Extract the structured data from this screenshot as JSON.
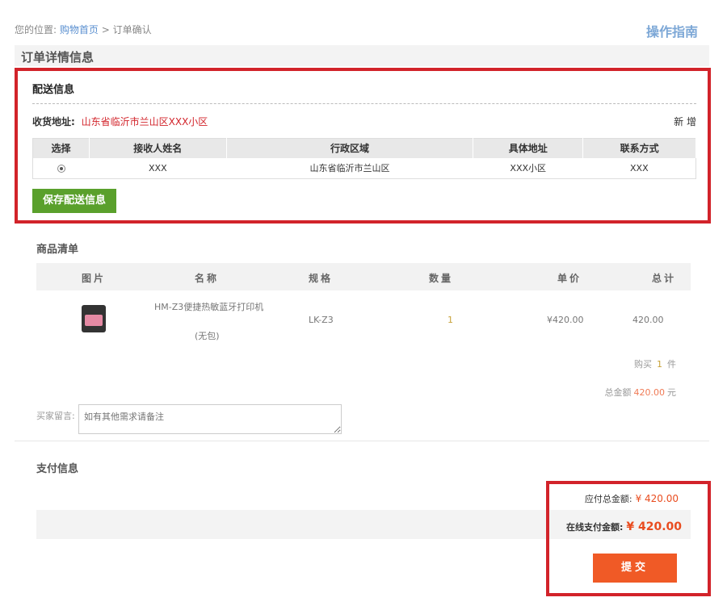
{
  "breadcrumb": {
    "prefix": "您的位置:",
    "home": "购物首页",
    "sep": ">",
    "current": "订单确认"
  },
  "guide_link": "操作指南",
  "section_title": "订单详情信息",
  "delivery": {
    "title": "配送信息",
    "address_label": "收货地址:",
    "address_value": "山东省临沂市兰山区XXX小区",
    "add_new": "新 增",
    "columns": [
      "选择",
      "接收人姓名",
      "行政区域",
      "具体地址",
      "联系方式"
    ],
    "rows": [
      {
        "selected": true,
        "name": "XXX",
        "region": "山东省临沂市兰山区",
        "detail": "XXX小区",
        "contact": "XXX"
      }
    ],
    "save_label": "保存配送信息"
  },
  "goods": {
    "title": "商品清单",
    "columns": [
      "图片",
      "名称",
      "规格",
      "数量",
      "单价",
      "总计"
    ],
    "items": [
      {
        "name": "HM-Z3便捷热敏蓝牙打印机",
        "note": "(无包)",
        "spec": "LK-Z3",
        "qty": "1",
        "unit_price": "¥420.00",
        "total": "420.00"
      }
    ],
    "buy_prefix": "购买",
    "buy_count": "1",
    "buy_suffix": "件",
    "total_prefix": "总金额",
    "total_amount": "420.00",
    "total_suffix": "元"
  },
  "remark": {
    "label": "买家留言:",
    "placeholder": "如有其他需求请备注"
  },
  "payment": {
    "title": "支付信息",
    "due_label": "应付总金额:",
    "due_value": "¥ 420.00",
    "online_label": "在线支付金额:",
    "online_value": "¥ 420.00",
    "submit_label": "提交"
  },
  "colors": {
    "highlight_border": "#d2232a",
    "save_button": "#5aa02c",
    "submit_button": "#f05a26",
    "price": "#e94c1f"
  }
}
